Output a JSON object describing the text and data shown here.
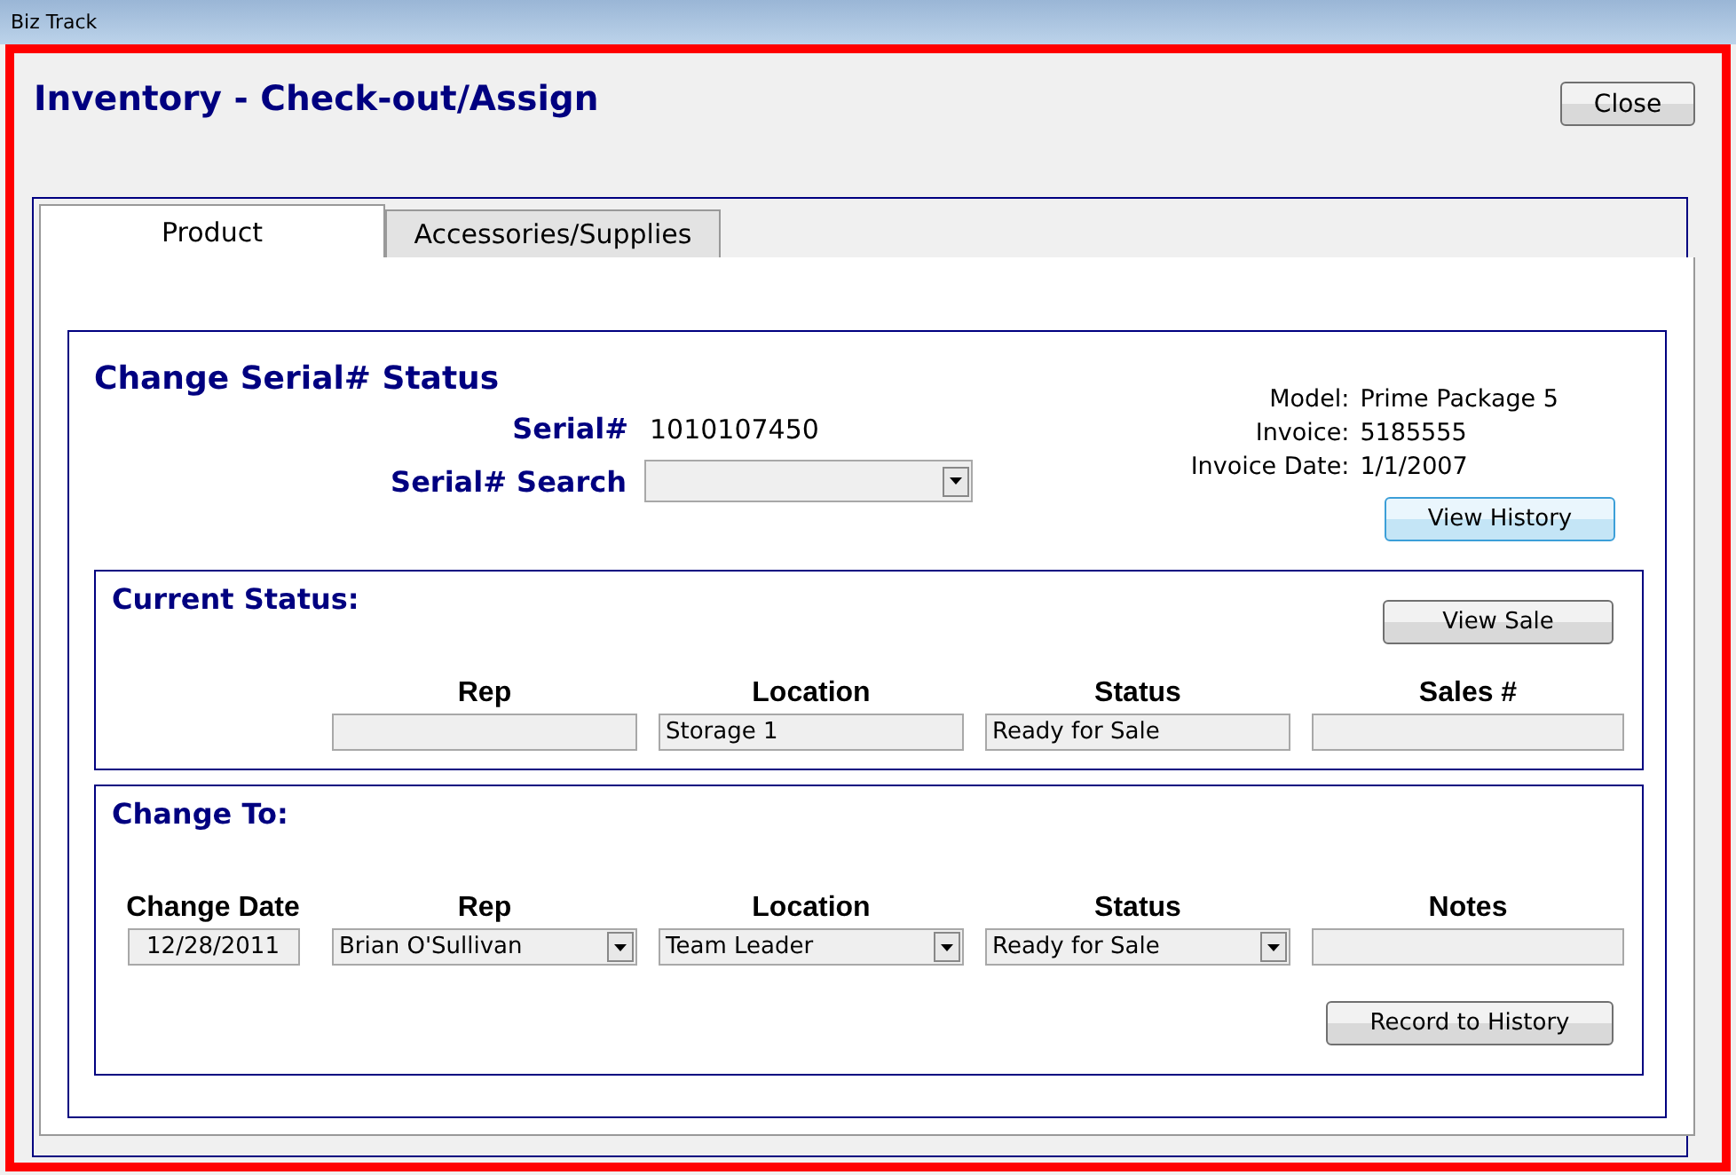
{
  "window": {
    "title": "Biz Track"
  },
  "header": {
    "title": "Inventory - Check-out/Assign",
    "close_button": "Close"
  },
  "tabs": [
    {
      "label": "Product",
      "selected": true
    },
    {
      "label": "Accessories/Supplies",
      "selected": false
    }
  ],
  "section": {
    "title": "Change Serial# Status",
    "serial": {
      "label": "Serial#",
      "value": "1010107450"
    },
    "serial_search": {
      "label": "Serial# Search"
    },
    "info": [
      {
        "label": "Model:",
        "value": "Prime Package 5"
      },
      {
        "label": "Invoice:",
        "value": "5185555"
      },
      {
        "label": "Invoice Date:",
        "value": "1/1/2007"
      }
    ],
    "view_history_button": "View History"
  },
  "current_status": {
    "title": "Current Status:",
    "view_sale_button": "View Sale",
    "fields": [
      {
        "label": "Rep"
      },
      {
        "label": "Location",
        "value": "Storage 1"
      },
      {
        "label": "Status",
        "value": "Ready for Sale"
      },
      {
        "label": "Sales #"
      }
    ]
  },
  "change_to": {
    "title": "Change To:",
    "record_button": "Record to History",
    "fields": [
      {
        "label": "Change Date",
        "kind": "date",
        "value": "12/28/2011"
      },
      {
        "label": "Rep",
        "kind": "dropdown",
        "value": "Brian O'Sullivan"
      },
      {
        "label": "Location",
        "kind": "dropdown",
        "value": "Team Leader"
      },
      {
        "label": "Status",
        "kind": "dropdown",
        "value": "Ready for Sale"
      },
      {
        "label": "Notes",
        "kind": "text"
      }
    ]
  }
}
